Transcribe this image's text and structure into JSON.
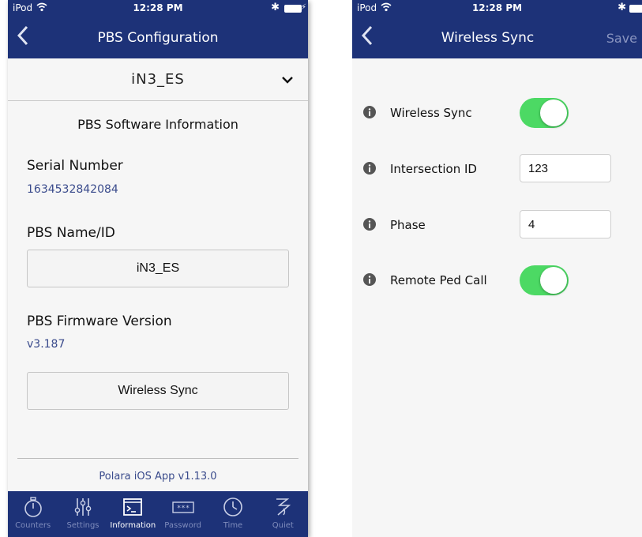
{
  "status_bar": {
    "carrier": "iPod",
    "time": "12:28 PM"
  },
  "left": {
    "nav_title": "PBS Configuration",
    "device_select": {
      "value": "iN3_ES"
    },
    "section_title": "PBS Software Information",
    "serial": {
      "label": "Serial Number",
      "value": "1634532842084"
    },
    "pbs_name": {
      "label": "PBS Name/ID",
      "button": "iN3_ES"
    },
    "firmware": {
      "label": "PBS Firmware Version",
      "value": "v3.187"
    },
    "wireless_sync_button": "Wireless Sync",
    "footer": "Polara iOS App v1.13.0",
    "tabs": [
      {
        "label": "Counters",
        "icon": "stopwatch-icon"
      },
      {
        "label": "Settings",
        "icon": "sliders-icon"
      },
      {
        "label": "Information",
        "icon": "terminal-icon"
      },
      {
        "label": "Password",
        "icon": "password-icon"
      },
      {
        "label": "Time",
        "icon": "clock-icon"
      },
      {
        "label": "Quiet",
        "icon": "quiet-icon"
      }
    ],
    "active_tab": "Information"
  },
  "right": {
    "nav_title": "Wireless Sync",
    "save_label": "Save",
    "rows": [
      {
        "label": "Wireless Sync",
        "type": "toggle",
        "on": true
      },
      {
        "label": "Intersection ID",
        "type": "input",
        "value": "123"
      },
      {
        "label": "Phase",
        "type": "input",
        "value": "4"
      },
      {
        "label": "Remote Ped Call",
        "type": "toggle",
        "on": true
      }
    ]
  },
  "colors": {
    "nav_bar": "#1d3278",
    "toggle_on": "#4cd964",
    "link_text": "#3a4b8c",
    "tab_inactive": "#7f8cbc"
  }
}
